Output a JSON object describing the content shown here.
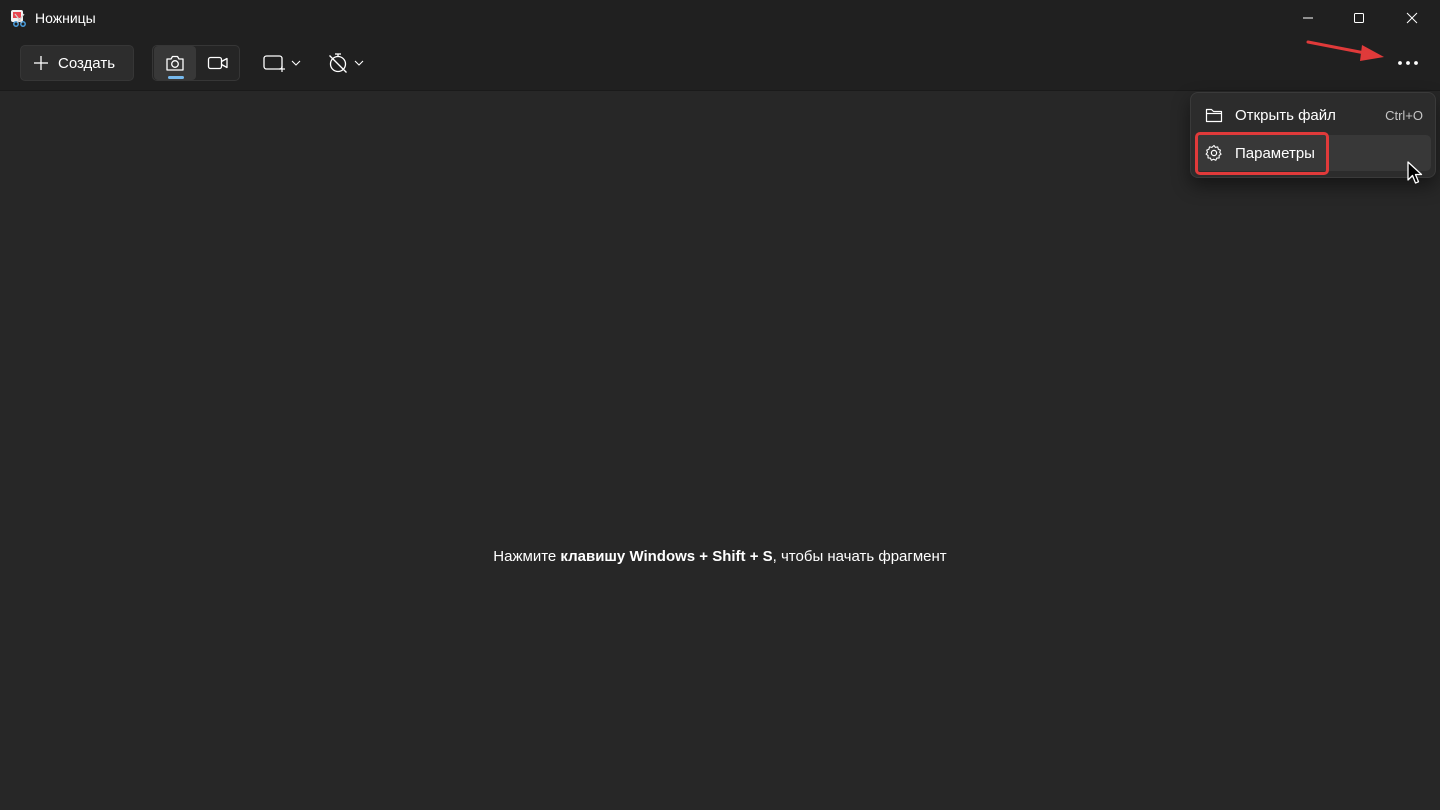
{
  "window": {
    "title": "Ножницы",
    "icon": "snipping-tool-icon",
    "controls": [
      "minimize-icon",
      "maximize-icon",
      "close-icon"
    ]
  },
  "toolbar": {
    "create_label": "Создать",
    "create_icon": "plus-icon",
    "modes": [
      {
        "icon": "camera-icon",
        "selected": true
      },
      {
        "icon": "video-icon",
        "selected": false
      }
    ],
    "shape_icon": "rectangle-snip-icon",
    "timer_icon": "no-timer-icon",
    "more_icon": "more-dots-icon"
  },
  "content": {
    "hint_prefix": "Нажмите ",
    "hint_bold": "клавишу Windows + Shift + S",
    "hint_suffix": ", чтобы начать фрагмент"
  },
  "menu": {
    "items": [
      {
        "label": "Открыть файл",
        "shortcut": "Ctrl+O",
        "icon": "folder-icon"
      },
      {
        "label": "Параметры",
        "shortcut": "",
        "icon": "gear-icon"
      }
    ]
  },
  "colors": {
    "background": "#272727",
    "titlebar": "#202020",
    "accent": "#76b9ed",
    "annotation": "#e03a3a"
  }
}
